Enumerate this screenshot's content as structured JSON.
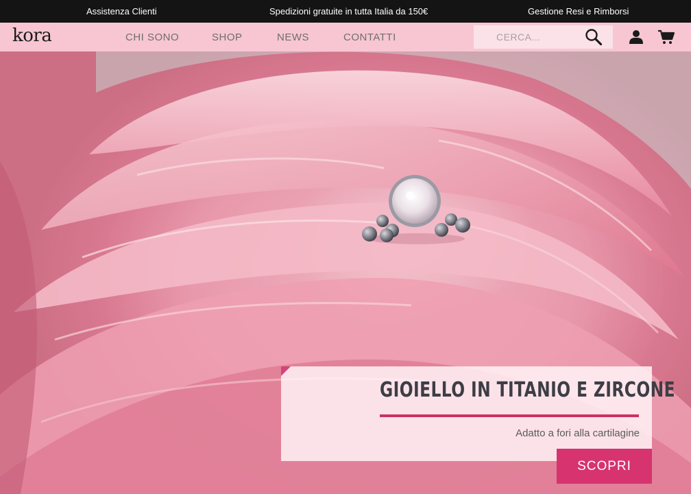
{
  "topbar": {
    "left": "Assistenza Clienti",
    "center": "Spedizioni gratuite in tutta Italia da 150€",
    "right": "Gestione Resi e Rimborsi"
  },
  "brand": {
    "logo": "kora"
  },
  "nav": [
    {
      "label": "CHI SONO"
    },
    {
      "label": "SHOP"
    },
    {
      "label": "NEWS"
    },
    {
      "label": "CONTATTI"
    }
  ],
  "search": {
    "placeholder": "CERCA...",
    "icon": "search-icon"
  },
  "header_icons": {
    "account": "user-icon",
    "cart": "cart-icon"
  },
  "hero": {
    "title": "GIOIELLO IN TITANIO E ZIRCONE",
    "subtitle": "Adatto a fori alla cartilagine",
    "cta_label": "SCOPRI"
  },
  "colors": {
    "topbar_bg": "#141414",
    "navbar_bg": "#f7c6d2",
    "accent": "#d6336f",
    "rule": "#c93266"
  }
}
